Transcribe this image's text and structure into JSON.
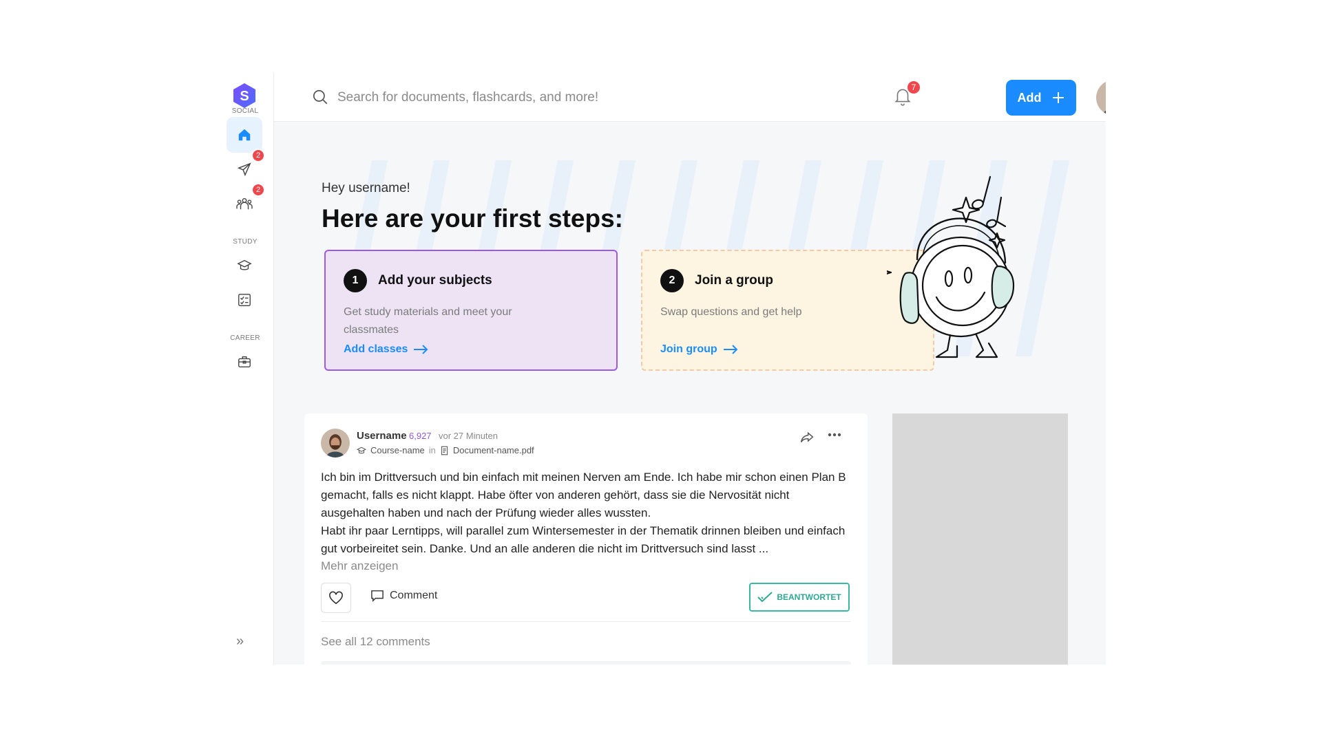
{
  "sidebar": {
    "logo_letter": "S",
    "sections": {
      "social": "SOCIAL",
      "study": "STUDY",
      "career": "CAREER"
    },
    "items": [
      {
        "icon": "home-icon",
        "active": true
      },
      {
        "icon": "send-icon",
        "badge": "2"
      },
      {
        "icon": "groups-icon",
        "badge": "2"
      },
      {
        "icon": "graduation-cap-icon"
      },
      {
        "icon": "checklist-icon"
      },
      {
        "icon": "briefcase-icon"
      }
    ],
    "expand_glyph": "»"
  },
  "topbar": {
    "search_placeholder": "Search for documents, flashcards, and more!",
    "notification_count": "7",
    "add_label": "Add"
  },
  "hero": {
    "greeting": "Hey username!",
    "title": "Here are your first steps:",
    "steps": [
      {
        "number": "1",
        "title": "Add your subjects",
        "description": "Get study materials and meet your classmates",
        "link": "Add classes"
      },
      {
        "number": "2",
        "title": "Join a group",
        "description": "Swap questions and get help",
        "link": "Join group"
      }
    ]
  },
  "post": {
    "username": "Username",
    "points": "6,927",
    "time": "vor 27 Minuten",
    "course": "Course-name",
    "in_label": "in",
    "document": "Document-name.pdf",
    "body_p1": "Ich bin im Drittversuch und bin einfach mit meinen Nerven am Ende. Ich habe mir schon einen Plan B gemacht, falls es nicht klappt. Habe öfter von anderen gehört, dass sie die Nervosität nicht ausgehalten haben und nach der Prüfung wieder alles wussten.",
    "body_p2": "Habt ihr paar Lerntipps, will parallel zum Wintersemester in der Thematik drinnen bleiben und einfach gut vorbeireitet sein. Danke. Und an alle anderen die nicht im Drittversuch sind lasst ...",
    "more_label": "Mehr anzeigen",
    "comment_label": "Comment",
    "answered_label": "BEANTWORTET",
    "see_all_label": "See all 12 comments"
  },
  "colors": {
    "accent": "#1a8cff",
    "badge": "#f0474d",
    "card1_bg": "#ede3f5",
    "card1_border": "#9b59e6",
    "card2_bg": "#fdf5e2",
    "answered": "#3ab7a4"
  }
}
